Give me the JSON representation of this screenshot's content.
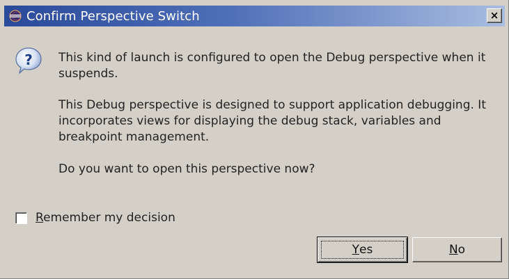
{
  "dialog": {
    "title": "Confirm Perspective Switch",
    "title_icon": "eclipse-icon",
    "close_label": "×",
    "message_icon": "question-icon",
    "message_paragraphs": [
      "This kind of launch is configured to open the Debug perspective when it suspends.",
      "This Debug perspective is designed to support application debugging.  It incorporates views for displaying the debug stack, variables and breakpoint management.",
      "Do you want to open this perspective now?"
    ],
    "remember": {
      "checked": false,
      "mnemonic": "R",
      "label_rest": "emember my decision"
    },
    "buttons": {
      "yes": {
        "mnemonic": "Y",
        "rest": "es"
      },
      "no": {
        "mnemonic": "N",
        "rest": "o"
      }
    }
  },
  "colors": {
    "titlebar_start": "#2a4a9a",
    "titlebar_end": "#a9bde0",
    "dialog_bg": "#d4d0c8"
  }
}
